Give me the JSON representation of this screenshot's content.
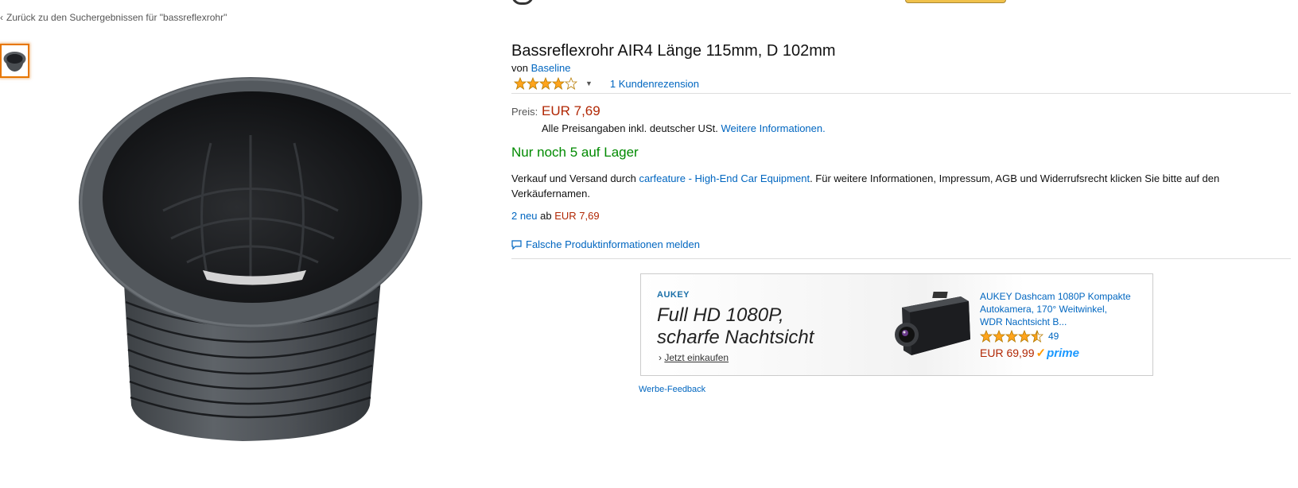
{
  "nav": {
    "back_link": "Zurück zu den Suchergebnissen für \"bassreflexrohr\""
  },
  "product": {
    "title": "Bassreflexrohr AIR4 Länge 115mm, D 102mm",
    "by_prefix": "von ",
    "brand": "Baseline",
    "rating": 4,
    "rating_max": 5,
    "review_count_text": "1 Kundenrezension",
    "price_label": "Preis:",
    "price": "EUR 7,69",
    "vat_text": "Alle Preisangaben inkl. deutscher USt. ",
    "vat_link": "Weitere Informationen.",
    "stock": "Nur noch 5 auf Lager",
    "seller_prefix": "Verkauf und Versand durch ",
    "seller_link": "carfeature - High-End Car Equipment",
    "seller_suffix": ". Für weitere Informationen, Impressum, AGB und Widerrufsrecht klicken Sie bitte auf den Verkäufernamen.",
    "offers_link": "2 neu",
    "offers_mid": " ab ",
    "offers_price": "EUR 7,69",
    "report_link": "Falsche Produktinformationen melden"
  },
  "ad": {
    "brand": "AUKEY",
    "headline_1": "Full HD 1080P,",
    "headline_2": "scharfe Nachtsicht",
    "shop_link": "Jetzt einkaufen",
    "product_title": "AUKEY Dashcam 1080P Kompakte Autokamera, 170° Weitwinkel, WDR Nachtsicht B...",
    "rating": 4.5,
    "review_count": "49",
    "price": "EUR 69,99",
    "prime": "prime",
    "feedback": "Werbe-Feedback"
  },
  "colors": {
    "price": "#b12704",
    "link": "#0066c0",
    "in_stock": "#008a00",
    "star": "#ffa41c"
  },
  "icons": [
    "chevron-left-icon",
    "dropdown-caret-icon",
    "comment-icon",
    "prime-check-icon"
  ]
}
